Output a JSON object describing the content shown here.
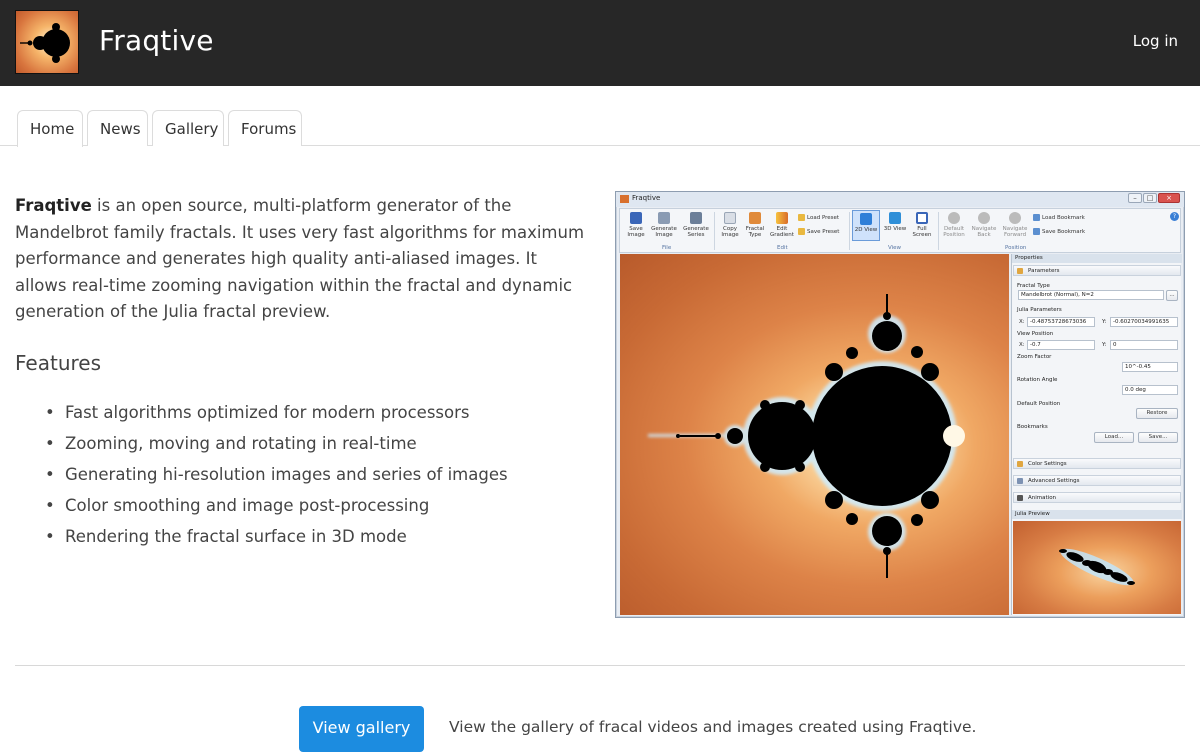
{
  "header": {
    "site_title": "Fraqtive",
    "login_label": "Log in"
  },
  "tabs": [
    {
      "label": "Home",
      "active": true
    },
    {
      "label": "News",
      "active": false
    },
    {
      "label": "Gallery",
      "active": false
    },
    {
      "label": "Forums",
      "active": false
    }
  ],
  "intro": {
    "name": "Fraqtive",
    "text": " is an open source, multi-platform generator of the Mandelbrot family fractals. It uses very fast algorithms for maximum performance and generates high quality anti-aliased images. It allows real-time zooming navigation within the fractal and dynamic generation of the Julia fractal preview."
  },
  "features": {
    "title": "Features",
    "items": [
      "Fast algorithms optimized for modern processors",
      "Zooming, moving and rotating in real-time",
      "Generating hi-resolution images and series of images",
      "Color smoothing and image post-processing",
      "Rendering the fractal surface in 3D mode"
    ]
  },
  "screenshot": {
    "window_title": "Fraqtive",
    "ribbon": {
      "save_image": "Save Image",
      "generate_image": "Generate Image",
      "generate_series": "Generate Series",
      "group_file": "File",
      "copy_image": "Copy Image",
      "fractal_type": "Fractal Type",
      "edit_gradient": "Edit Gradient",
      "load_preset": "Load Preset",
      "save_preset": "Save Preset",
      "group_edit": "Edit",
      "view_2d": "2D View",
      "view_3d": "3D View",
      "full_screen": "Full Screen",
      "group_view": "View",
      "default_position": "Default Position",
      "navigate_back": "Navigate Back",
      "navigate_forward": "Navigate Forward",
      "load_bookmark": "Load Bookmark",
      "save_bookmark": "Save Bookmark",
      "group_position": "Position"
    },
    "properties": {
      "title": "Properties",
      "parameters": "Parameters",
      "fractal_type_label": "Fractal Type",
      "fractal_type_value": "Mandelbrot (Normal), N=2",
      "browse": "...",
      "julia_parameters": "Julia Parameters",
      "julia_x_label": "X:",
      "julia_x": "-0.48753728673036",
      "julia_y_label": "Y:",
      "julia_y": "-0.60270034991635",
      "view_position": "View Position",
      "pos_x_label": "X:",
      "pos_x": "-0.7",
      "pos_y_label": "Y:",
      "pos_y": "0",
      "zoom_factor": "Zoom Factor",
      "zoom_value": "10^-0.45",
      "rotation_angle": "Rotation Angle",
      "rotation_value": "0.0 deg",
      "default_position": "Default Position",
      "restore": "Restore",
      "bookmarks": "Bookmarks",
      "load": "Load...",
      "save": "Save...",
      "color_settings": "Color Settings",
      "advanced_settings": "Advanced Settings",
      "animation": "Animation",
      "julia_preview": "Julia Preview"
    }
  },
  "footer": {
    "gallery_button": "View gallery",
    "gallery_text": "View the gallery of fracal videos and images created using Fraqtive."
  }
}
